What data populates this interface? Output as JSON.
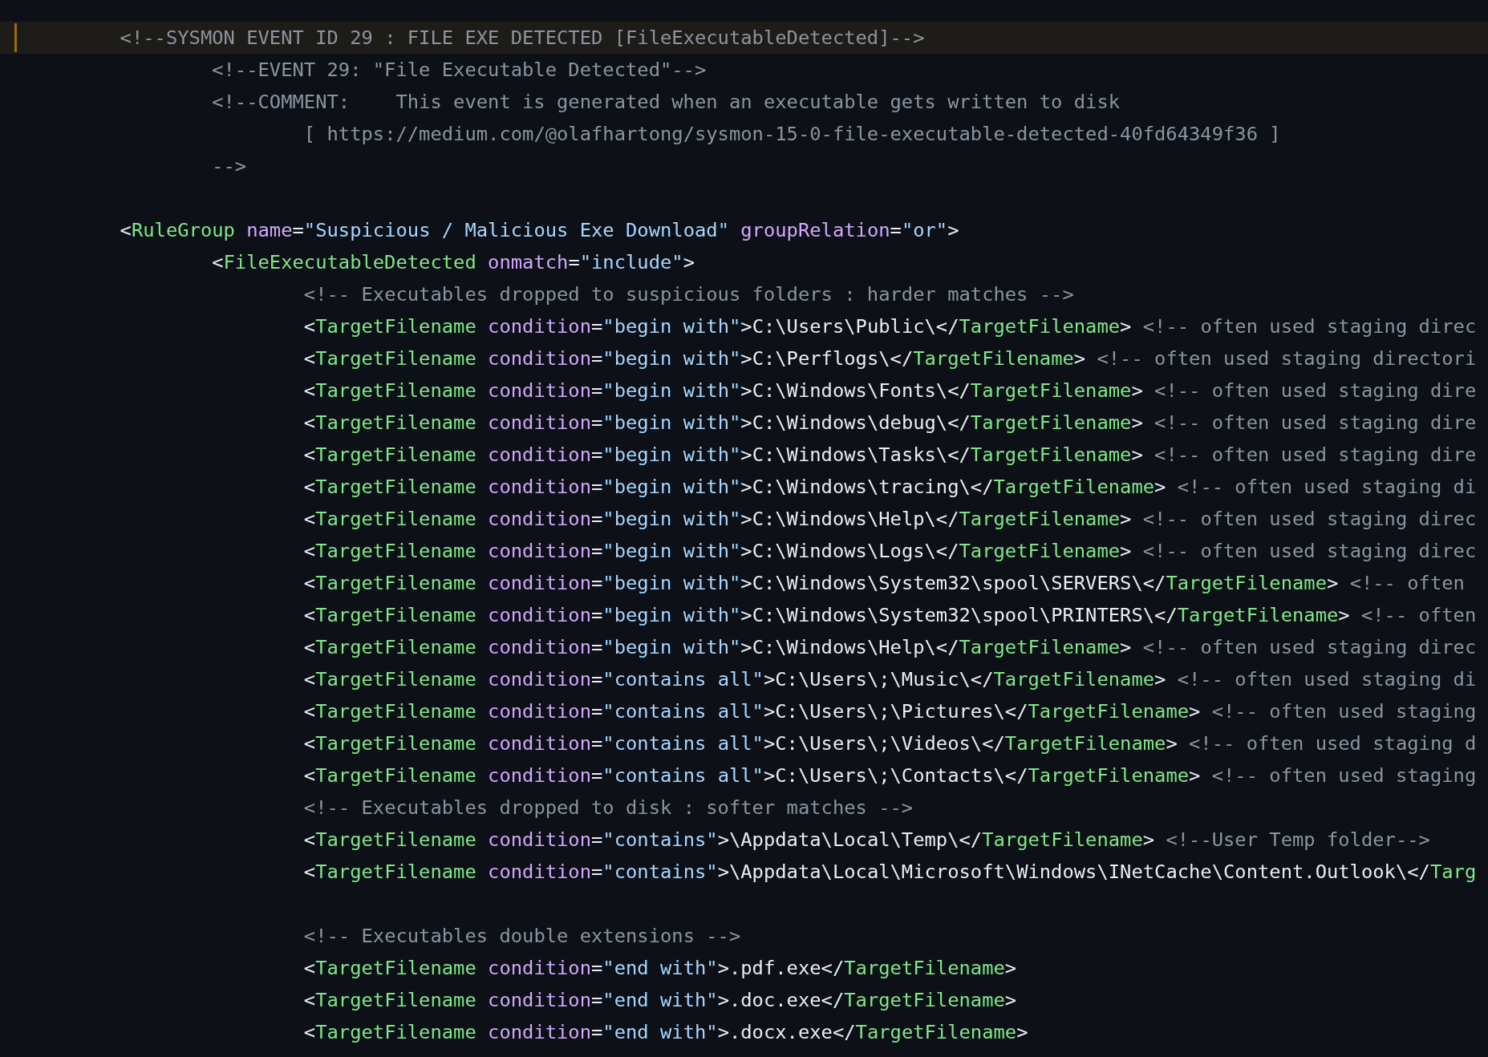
{
  "editor": {
    "lines": [
      {
        "kind": "code",
        "highlighted": true,
        "tokens": [
          {
            "kind": "comment",
            "text": "<!--SYSMON EVENT ID 29 : FILE EXE DETECTED [FileExecutableDetected]-->"
          }
        ],
        "children": [
          {
            "kind": "code",
            "highlighted": false,
            "tokens": [
              {
                "kind": "comment",
                "text": "<!--EVENT 29: \"File Executable Detected\"-->"
              }
            ]
          },
          {
            "kind": "code",
            "highlighted": false,
            "tokens": [
              {
                "kind": "comment",
                "text": "<!--COMMENT:    This event is generated when an executable gets written to disk"
              }
            ],
            "children": [
              {
                "kind": "code",
                "highlighted": false,
                "tokens": [
                  {
                    "kind": "comment",
                    "text": "[ https://medium.com/@olafhartong/sysmon-15-0-file-executable-detected-40fd64349f36 ]"
                  }
                ]
              }
            ]
          },
          {
            "kind": "code",
            "highlighted": false,
            "tokens": [
              {
                "kind": "comment",
                "text": "-->"
              }
            ]
          }
        ]
      },
      {
        "kind": "blank"
      },
      {
        "kind": "code",
        "highlighted": false,
        "tokens": [
          {
            "kind": "punct",
            "text": "<"
          },
          {
            "kind": "tag",
            "text": "RuleGroup"
          },
          {
            "kind": "attr",
            "text": " name"
          },
          {
            "kind": "punct",
            "text": "="
          },
          {
            "kind": "string",
            "text": "\"Suspicious / Malicious Exe Download\""
          },
          {
            "kind": "attr",
            "text": " groupRelation"
          },
          {
            "kind": "punct",
            "text": "="
          },
          {
            "kind": "string",
            "text": "\"or\""
          },
          {
            "kind": "punct",
            "text": ">"
          }
        ],
        "children": [
          {
            "kind": "code",
            "highlighted": false,
            "tokens": [
              {
                "kind": "punct",
                "text": "<"
              },
              {
                "kind": "tag",
                "text": "FileExecutableDetected"
              },
              {
                "kind": "attr",
                "text": " onmatch"
              },
              {
                "kind": "punct",
                "text": "="
              },
              {
                "kind": "string",
                "text": "\"include\""
              },
              {
                "kind": "punct",
                "text": ">"
              }
            ],
            "children": [
              {
                "kind": "code",
                "highlighted": false,
                "tokens": [
                  {
                    "kind": "comment",
                    "text": "<!-- Executables dropped to suspicious folders : harder matches -->"
                  }
                ]
              },
              {
                "kind": "code",
                "highlighted": false,
                "tokens": [
                  {
                    "kind": "punct",
                    "text": "<"
                  },
                  {
                    "kind": "tag",
                    "text": "TargetFilename"
                  },
                  {
                    "kind": "attr",
                    "text": " condition"
                  },
                  {
                    "kind": "punct",
                    "text": "="
                  },
                  {
                    "kind": "string",
                    "text": "\"begin with\""
                  },
                  {
                    "kind": "punct",
                    "text": ">"
                  },
                  {
                    "kind": "text",
                    "text": "C:\\Users\\Public\\"
                  },
                  {
                    "kind": "punct",
                    "text": "</"
                  },
                  {
                    "kind": "tag",
                    "text": "TargetFilename"
                  },
                  {
                    "kind": "punct",
                    "text": ">"
                  },
                  {
                    "kind": "comment",
                    "text": " <!-- often used staging direc"
                  }
                ]
              },
              {
                "kind": "code",
                "highlighted": false,
                "tokens": [
                  {
                    "kind": "punct",
                    "text": "<"
                  },
                  {
                    "kind": "tag",
                    "text": "TargetFilename"
                  },
                  {
                    "kind": "attr",
                    "text": " condition"
                  },
                  {
                    "kind": "punct",
                    "text": "="
                  },
                  {
                    "kind": "string",
                    "text": "\"begin with\""
                  },
                  {
                    "kind": "punct",
                    "text": ">"
                  },
                  {
                    "kind": "text",
                    "text": "C:\\Perflogs\\"
                  },
                  {
                    "kind": "punct",
                    "text": "</"
                  },
                  {
                    "kind": "tag",
                    "text": "TargetFilename"
                  },
                  {
                    "kind": "punct",
                    "text": ">"
                  },
                  {
                    "kind": "comment",
                    "text": " <!-- often used staging directori"
                  }
                ]
              },
              {
                "kind": "code",
                "highlighted": false,
                "tokens": [
                  {
                    "kind": "punct",
                    "text": "<"
                  },
                  {
                    "kind": "tag",
                    "text": "TargetFilename"
                  },
                  {
                    "kind": "attr",
                    "text": " condition"
                  },
                  {
                    "kind": "punct",
                    "text": "="
                  },
                  {
                    "kind": "string",
                    "text": "\"begin with\""
                  },
                  {
                    "kind": "punct",
                    "text": ">"
                  },
                  {
                    "kind": "text",
                    "text": "C:\\Windows\\Fonts\\"
                  },
                  {
                    "kind": "punct",
                    "text": "</"
                  },
                  {
                    "kind": "tag",
                    "text": "TargetFilename"
                  },
                  {
                    "kind": "punct",
                    "text": ">"
                  },
                  {
                    "kind": "comment",
                    "text": " <!-- often used staging dire"
                  }
                ]
              },
              {
                "kind": "code",
                "highlighted": false,
                "tokens": [
                  {
                    "kind": "punct",
                    "text": "<"
                  },
                  {
                    "kind": "tag",
                    "text": "TargetFilename"
                  },
                  {
                    "kind": "attr",
                    "text": " condition"
                  },
                  {
                    "kind": "punct",
                    "text": "="
                  },
                  {
                    "kind": "string",
                    "text": "\"begin with\""
                  },
                  {
                    "kind": "punct",
                    "text": ">"
                  },
                  {
                    "kind": "text",
                    "text": "C:\\Windows\\debug\\"
                  },
                  {
                    "kind": "punct",
                    "text": "</"
                  },
                  {
                    "kind": "tag",
                    "text": "TargetFilename"
                  },
                  {
                    "kind": "punct",
                    "text": ">"
                  },
                  {
                    "kind": "comment",
                    "text": " <!-- often used staging dire"
                  }
                ]
              },
              {
                "kind": "code",
                "highlighted": false,
                "tokens": [
                  {
                    "kind": "punct",
                    "text": "<"
                  },
                  {
                    "kind": "tag",
                    "text": "TargetFilename"
                  },
                  {
                    "kind": "attr",
                    "text": " condition"
                  },
                  {
                    "kind": "punct",
                    "text": "="
                  },
                  {
                    "kind": "string",
                    "text": "\"begin with\""
                  },
                  {
                    "kind": "punct",
                    "text": ">"
                  },
                  {
                    "kind": "text",
                    "text": "C:\\Windows\\Tasks\\"
                  },
                  {
                    "kind": "punct",
                    "text": "</"
                  },
                  {
                    "kind": "tag",
                    "text": "TargetFilename"
                  },
                  {
                    "kind": "punct",
                    "text": ">"
                  },
                  {
                    "kind": "comment",
                    "text": " <!-- often used staging dire"
                  }
                ]
              },
              {
                "kind": "code",
                "highlighted": false,
                "tokens": [
                  {
                    "kind": "punct",
                    "text": "<"
                  },
                  {
                    "kind": "tag",
                    "text": "TargetFilename"
                  },
                  {
                    "kind": "attr",
                    "text": " condition"
                  },
                  {
                    "kind": "punct",
                    "text": "="
                  },
                  {
                    "kind": "string",
                    "text": "\"begin with\""
                  },
                  {
                    "kind": "punct",
                    "text": ">"
                  },
                  {
                    "kind": "text",
                    "text": "C:\\Windows\\tracing\\"
                  },
                  {
                    "kind": "punct",
                    "text": "</"
                  },
                  {
                    "kind": "tag",
                    "text": "TargetFilename"
                  },
                  {
                    "kind": "punct",
                    "text": ">"
                  },
                  {
                    "kind": "comment",
                    "text": " <!-- often used staging di"
                  }
                ]
              },
              {
                "kind": "code",
                "highlighted": false,
                "tokens": [
                  {
                    "kind": "punct",
                    "text": "<"
                  },
                  {
                    "kind": "tag",
                    "text": "TargetFilename"
                  },
                  {
                    "kind": "attr",
                    "text": " condition"
                  },
                  {
                    "kind": "punct",
                    "text": "="
                  },
                  {
                    "kind": "string",
                    "text": "\"begin with\""
                  },
                  {
                    "kind": "punct",
                    "text": ">"
                  },
                  {
                    "kind": "text",
                    "text": "C:\\Windows\\Help\\"
                  },
                  {
                    "kind": "punct",
                    "text": "</"
                  },
                  {
                    "kind": "tag",
                    "text": "TargetFilename"
                  },
                  {
                    "kind": "punct",
                    "text": ">"
                  },
                  {
                    "kind": "comment",
                    "text": " <!-- often used staging direc"
                  }
                ]
              },
              {
                "kind": "code",
                "highlighted": false,
                "tokens": [
                  {
                    "kind": "punct",
                    "text": "<"
                  },
                  {
                    "kind": "tag",
                    "text": "TargetFilename"
                  },
                  {
                    "kind": "attr",
                    "text": " condition"
                  },
                  {
                    "kind": "punct",
                    "text": "="
                  },
                  {
                    "kind": "string",
                    "text": "\"begin with\""
                  },
                  {
                    "kind": "punct",
                    "text": ">"
                  },
                  {
                    "kind": "text",
                    "text": "C:\\Windows\\Logs\\"
                  },
                  {
                    "kind": "punct",
                    "text": "</"
                  },
                  {
                    "kind": "tag",
                    "text": "TargetFilename"
                  },
                  {
                    "kind": "punct",
                    "text": ">"
                  },
                  {
                    "kind": "comment",
                    "text": " <!-- often used staging direc"
                  }
                ]
              },
              {
                "kind": "code",
                "highlighted": false,
                "tokens": [
                  {
                    "kind": "punct",
                    "text": "<"
                  },
                  {
                    "kind": "tag",
                    "text": "TargetFilename"
                  },
                  {
                    "kind": "attr",
                    "text": " condition"
                  },
                  {
                    "kind": "punct",
                    "text": "="
                  },
                  {
                    "kind": "string",
                    "text": "\"begin with\""
                  },
                  {
                    "kind": "punct",
                    "text": ">"
                  },
                  {
                    "kind": "text",
                    "text": "C:\\Windows\\System32\\spool\\SERVERS\\"
                  },
                  {
                    "kind": "punct",
                    "text": "</"
                  },
                  {
                    "kind": "tag",
                    "text": "TargetFilename"
                  },
                  {
                    "kind": "punct",
                    "text": ">"
                  },
                  {
                    "kind": "comment",
                    "text": " <!-- often"
                  }
                ]
              },
              {
                "kind": "code",
                "highlighted": false,
                "tokens": [
                  {
                    "kind": "punct",
                    "text": "<"
                  },
                  {
                    "kind": "tag",
                    "text": "TargetFilename"
                  },
                  {
                    "kind": "attr",
                    "text": " condition"
                  },
                  {
                    "kind": "punct",
                    "text": "="
                  },
                  {
                    "kind": "string",
                    "text": "\"begin with\""
                  },
                  {
                    "kind": "punct",
                    "text": ">"
                  },
                  {
                    "kind": "text",
                    "text": "C:\\Windows\\System32\\spool\\PRINTERS\\"
                  },
                  {
                    "kind": "punct",
                    "text": "</"
                  },
                  {
                    "kind": "tag",
                    "text": "TargetFilename"
                  },
                  {
                    "kind": "punct",
                    "text": ">"
                  },
                  {
                    "kind": "comment",
                    "text": " <!-- often"
                  }
                ]
              },
              {
                "kind": "code",
                "highlighted": false,
                "tokens": [
                  {
                    "kind": "punct",
                    "text": "<"
                  },
                  {
                    "kind": "tag",
                    "text": "TargetFilename"
                  },
                  {
                    "kind": "attr",
                    "text": " condition"
                  },
                  {
                    "kind": "punct",
                    "text": "="
                  },
                  {
                    "kind": "string",
                    "text": "\"begin with\""
                  },
                  {
                    "kind": "punct",
                    "text": ">"
                  },
                  {
                    "kind": "text",
                    "text": "C:\\Windows\\Help\\"
                  },
                  {
                    "kind": "punct",
                    "text": "</"
                  },
                  {
                    "kind": "tag",
                    "text": "TargetFilename"
                  },
                  {
                    "kind": "punct",
                    "text": ">"
                  },
                  {
                    "kind": "comment",
                    "text": " <!-- often used staging direc"
                  }
                ]
              },
              {
                "kind": "code",
                "highlighted": false,
                "tokens": [
                  {
                    "kind": "punct",
                    "text": "<"
                  },
                  {
                    "kind": "tag",
                    "text": "TargetFilename"
                  },
                  {
                    "kind": "attr",
                    "text": " condition"
                  },
                  {
                    "kind": "punct",
                    "text": "="
                  },
                  {
                    "kind": "string",
                    "text": "\"contains all\""
                  },
                  {
                    "kind": "punct",
                    "text": ">"
                  },
                  {
                    "kind": "text",
                    "text": "C:\\Users\\;\\Music\\"
                  },
                  {
                    "kind": "punct",
                    "text": "</"
                  },
                  {
                    "kind": "tag",
                    "text": "TargetFilename"
                  },
                  {
                    "kind": "punct",
                    "text": ">"
                  },
                  {
                    "kind": "comment",
                    "text": " <!-- often used staging di"
                  }
                ]
              },
              {
                "kind": "code",
                "highlighted": false,
                "tokens": [
                  {
                    "kind": "punct",
                    "text": "<"
                  },
                  {
                    "kind": "tag",
                    "text": "TargetFilename"
                  },
                  {
                    "kind": "attr",
                    "text": " condition"
                  },
                  {
                    "kind": "punct",
                    "text": "="
                  },
                  {
                    "kind": "string",
                    "text": "\"contains all\""
                  },
                  {
                    "kind": "punct",
                    "text": ">"
                  },
                  {
                    "kind": "text",
                    "text": "C:\\Users\\;\\Pictures\\"
                  },
                  {
                    "kind": "punct",
                    "text": "</"
                  },
                  {
                    "kind": "tag",
                    "text": "TargetFilename"
                  },
                  {
                    "kind": "punct",
                    "text": ">"
                  },
                  {
                    "kind": "comment",
                    "text": " <!-- often used staging"
                  }
                ]
              },
              {
                "kind": "code",
                "highlighted": false,
                "tokens": [
                  {
                    "kind": "punct",
                    "text": "<"
                  },
                  {
                    "kind": "tag",
                    "text": "TargetFilename"
                  },
                  {
                    "kind": "attr",
                    "text": " condition"
                  },
                  {
                    "kind": "punct",
                    "text": "="
                  },
                  {
                    "kind": "string",
                    "text": "\"contains all\""
                  },
                  {
                    "kind": "punct",
                    "text": ">"
                  },
                  {
                    "kind": "text",
                    "text": "C:\\Users\\;\\Videos\\"
                  },
                  {
                    "kind": "punct",
                    "text": "</"
                  },
                  {
                    "kind": "tag",
                    "text": "TargetFilename"
                  },
                  {
                    "kind": "punct",
                    "text": ">"
                  },
                  {
                    "kind": "comment",
                    "text": " <!-- often used staging d"
                  }
                ]
              },
              {
                "kind": "code",
                "highlighted": false,
                "tokens": [
                  {
                    "kind": "punct",
                    "text": "<"
                  },
                  {
                    "kind": "tag",
                    "text": "TargetFilename"
                  },
                  {
                    "kind": "attr",
                    "text": " condition"
                  },
                  {
                    "kind": "punct",
                    "text": "="
                  },
                  {
                    "kind": "string",
                    "text": "\"contains all\""
                  },
                  {
                    "kind": "punct",
                    "text": ">"
                  },
                  {
                    "kind": "text",
                    "text": "C:\\Users\\;\\Contacts\\"
                  },
                  {
                    "kind": "punct",
                    "text": "</"
                  },
                  {
                    "kind": "tag",
                    "text": "TargetFilename"
                  },
                  {
                    "kind": "punct",
                    "text": ">"
                  },
                  {
                    "kind": "comment",
                    "text": " <!-- often used staging"
                  }
                ]
              },
              {
                "kind": "code",
                "highlighted": false,
                "tokens": [
                  {
                    "kind": "comment",
                    "text": "<!-- Executables dropped to disk : softer matches -->"
                  }
                ]
              },
              {
                "kind": "code",
                "highlighted": false,
                "tokens": [
                  {
                    "kind": "punct",
                    "text": "<"
                  },
                  {
                    "kind": "tag",
                    "text": "TargetFilename"
                  },
                  {
                    "kind": "attr",
                    "text": " condition"
                  },
                  {
                    "kind": "punct",
                    "text": "="
                  },
                  {
                    "kind": "string",
                    "text": "\"contains\""
                  },
                  {
                    "kind": "punct",
                    "text": ">"
                  },
                  {
                    "kind": "text",
                    "text": "\\Appdata\\Local\\Temp\\"
                  },
                  {
                    "kind": "punct",
                    "text": "</"
                  },
                  {
                    "kind": "tag",
                    "text": "TargetFilename"
                  },
                  {
                    "kind": "punct",
                    "text": ">"
                  },
                  {
                    "kind": "comment",
                    "text": " <!--User Temp folder-->"
                  }
                ]
              },
              {
                "kind": "code",
                "highlighted": false,
                "tokens": [
                  {
                    "kind": "punct",
                    "text": "<"
                  },
                  {
                    "kind": "tag",
                    "text": "TargetFilename"
                  },
                  {
                    "kind": "attr",
                    "text": " condition"
                  },
                  {
                    "kind": "punct",
                    "text": "="
                  },
                  {
                    "kind": "string",
                    "text": "\"contains\""
                  },
                  {
                    "kind": "punct",
                    "text": ">"
                  },
                  {
                    "kind": "text",
                    "text": "\\Appdata\\Local\\Microsoft\\Windows\\INetCache\\Content.Outlook\\"
                  },
                  {
                    "kind": "punct",
                    "text": "</"
                  },
                  {
                    "kind": "tag",
                    "text": "Targ"
                  }
                ]
              },
              {
                "kind": "blank"
              },
              {
                "kind": "code",
                "highlighted": false,
                "tokens": [
                  {
                    "kind": "comment",
                    "text": "<!-- Executables double extensions -->"
                  }
                ]
              },
              {
                "kind": "code",
                "highlighted": false,
                "tokens": [
                  {
                    "kind": "punct",
                    "text": "<"
                  },
                  {
                    "kind": "tag",
                    "text": "TargetFilename"
                  },
                  {
                    "kind": "attr",
                    "text": " condition"
                  },
                  {
                    "kind": "punct",
                    "text": "="
                  },
                  {
                    "kind": "string",
                    "text": "\"end with\""
                  },
                  {
                    "kind": "punct",
                    "text": ">"
                  },
                  {
                    "kind": "text",
                    "text": ".pdf.exe"
                  },
                  {
                    "kind": "punct",
                    "text": "</"
                  },
                  {
                    "kind": "tag",
                    "text": "TargetFilename"
                  },
                  {
                    "kind": "punct",
                    "text": ">"
                  }
                ]
              },
              {
                "kind": "code",
                "highlighted": false,
                "tokens": [
                  {
                    "kind": "punct",
                    "text": "<"
                  },
                  {
                    "kind": "tag",
                    "text": "TargetFilename"
                  },
                  {
                    "kind": "attr",
                    "text": " condition"
                  },
                  {
                    "kind": "punct",
                    "text": "="
                  },
                  {
                    "kind": "string",
                    "text": "\"end with\""
                  },
                  {
                    "kind": "punct",
                    "text": ">"
                  },
                  {
                    "kind": "text",
                    "text": ".doc.exe"
                  },
                  {
                    "kind": "punct",
                    "text": "</"
                  },
                  {
                    "kind": "tag",
                    "text": "TargetFilename"
                  },
                  {
                    "kind": "punct",
                    "text": ">"
                  }
                ]
              },
              {
                "kind": "code",
                "highlighted": false,
                "tokens": [
                  {
                    "kind": "punct",
                    "text": "<"
                  },
                  {
                    "kind": "tag",
                    "text": "TargetFilename"
                  },
                  {
                    "kind": "attr",
                    "text": " condition"
                  },
                  {
                    "kind": "punct",
                    "text": "="
                  },
                  {
                    "kind": "string",
                    "text": "\"end with\""
                  },
                  {
                    "kind": "punct",
                    "text": ">"
                  },
                  {
                    "kind": "text",
                    "text": ".docx.exe"
                  },
                  {
                    "kind": "punct",
                    "text": "</"
                  },
                  {
                    "kind": "tag",
                    "text": "TargetFilename"
                  },
                  {
                    "kind": "punct",
                    "text": ">"
                  }
                ]
              }
            ]
          }
        ]
      }
    ]
  }
}
